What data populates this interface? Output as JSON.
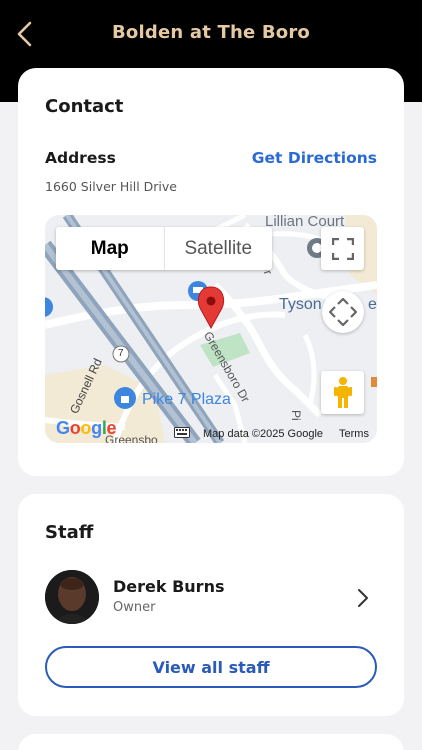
{
  "header": {
    "title": "Bolden at The Boro",
    "back_icon": "chevron-left-icon"
  },
  "contact": {
    "title": "Contact",
    "address_label": "Address",
    "directions_label": "Get Directions",
    "address_value": "1660 Silver Hill Drive",
    "map": {
      "toggle_map": "Map",
      "toggle_satellite": "Satellite",
      "attribution": "Map data ©2025 Google",
      "terms": "Terms",
      "logo": "Google",
      "labels": {
        "lillian": "Lillian Court",
        "tyson": "Tyson",
        "tyson_suffix": "eri",
        "greensboro": "Greensboro Dr",
        "greensboro_bottom": "Greensbo",
        "gosnell": "Gosnell Rd",
        "pike": "Pike 7 Plaza",
        "route": "7",
        "dr": "Dr",
        "pi": "Pi"
      }
    }
  },
  "staff": {
    "title": "Staff",
    "members": [
      {
        "name": "Derek Burns",
        "role": "Owner"
      }
    ],
    "view_all_label": "View all staff"
  },
  "colors": {
    "header_bg": "#000000",
    "header_title": "#e5c9a3",
    "link": "#2a6ad2",
    "button_border": "#2a5bb8",
    "page_bg": "#f2f2f4"
  }
}
